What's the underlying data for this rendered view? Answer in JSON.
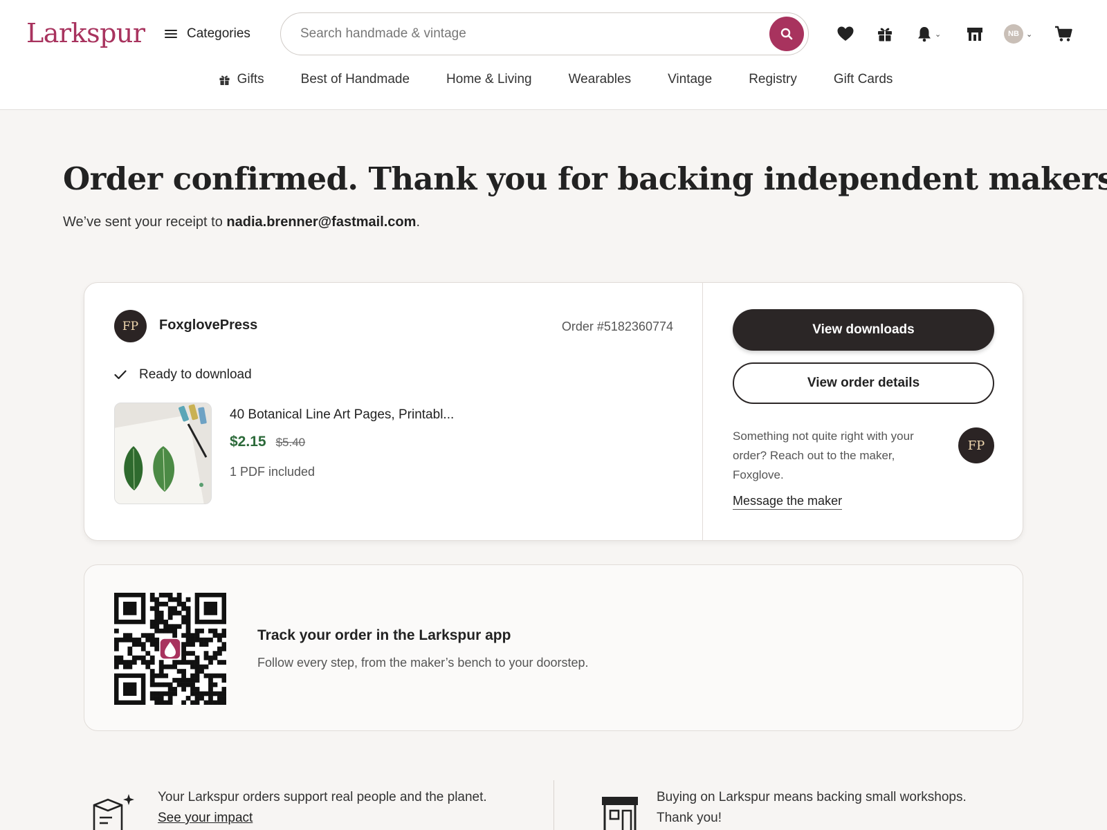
{
  "header": {
    "logo": "Larkspur",
    "categories_label": "Categories",
    "search_placeholder": "Search handmade & vintage",
    "avatar_initials": "NB",
    "nav": [
      "Gifts",
      "Best of Handmade",
      "Home & Living",
      "Wearables",
      "Vintage",
      "Registry",
      "Gift Cards"
    ]
  },
  "confirmation": {
    "title": "Order confirmed. Thank you for backing independent makers!",
    "receipt_prefix": "We’ve sent your receipt to ",
    "email": "nadia.brenner@fastmail.com",
    "receipt_suffix": "."
  },
  "order": {
    "shop_initials": "FP",
    "shop_name": "FoxglovePress",
    "order_number": "Order #5182360774",
    "status": "Ready to download",
    "item_title": "40 Botanical Line Art Pages, Printabl...",
    "price": "$2.15",
    "original_price": "$5.40",
    "included": "1 PDF included",
    "view_downloads": "View downloads",
    "view_order_details": "View order details",
    "help_text": "Something not quite right with your order? Reach out to the maker, Foxglove.",
    "message_link": "Message the maker"
  },
  "app_promo": {
    "title": "Track your order in the Larkspur app",
    "subtitle": "Follow every step, from the maker’s bench to your doorstep."
  },
  "footer": {
    "impact_text": "Your Larkspur orders support real people and the planet.",
    "impact_link": "See your impact",
    "workshops_text": "Buying on Larkspur means backing small workshops.",
    "workshops_thanks": "Thank you!"
  },
  "colors": {
    "brand": "#a8335e",
    "price_green": "#2c6a3a",
    "dark_button": "#2b2626"
  }
}
